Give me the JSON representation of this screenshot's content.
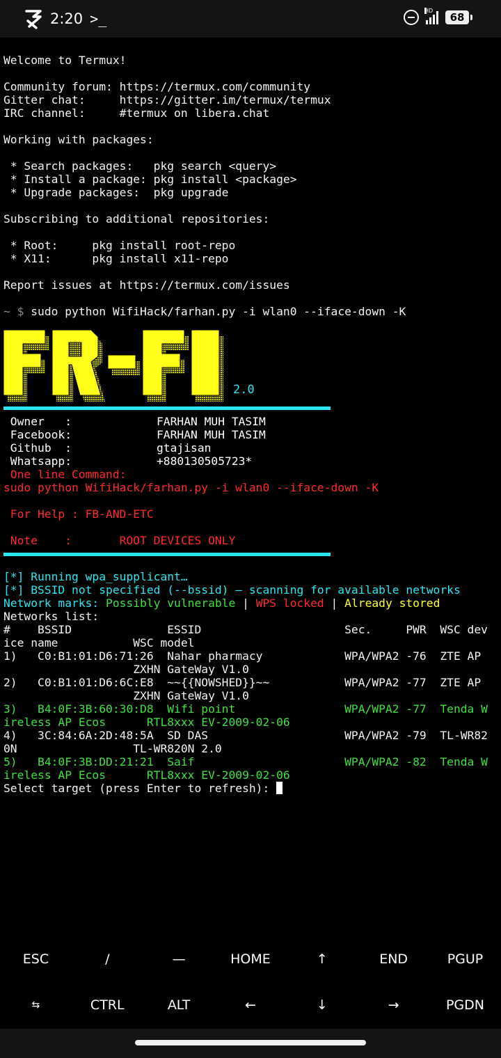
{
  "status_bar": {
    "time": "2:20",
    "app_icon": "termux-logo-icon",
    "prompt_icon": ">_",
    "network_label": "HD",
    "battery": "68"
  },
  "terminal": {
    "welcome": "Welcome to Termux!",
    "community_line": "Community forum: https://termux.com/community",
    "gitter_line": "Gitter chat:     https://gitter.im/termux/termux",
    "irc_line": "IRC channel:     #termux on libera.chat",
    "packages_header": "Working with packages:",
    "pkg_search": " * Search packages:   pkg search <query>",
    "pkg_install": " * Install a package: pkg install <package>",
    "pkg_upgrade": " * Upgrade packages:  pkg upgrade",
    "repos_header": "Subscribing to additional repositories:",
    "repo_root": " * Root:     pkg install root-repo",
    "repo_x11": " * X11:      pkg install x11-repo",
    "report_line": "Report issues at https://termux.com/issues",
    "prompt_symbol": "~ $",
    "command": " sudo python WifiHack/farhan.py -i wlan0 --iface-down -K"
  },
  "banner": {
    "logo_text": "FR-FI",
    "version": "2.0"
  },
  "info": {
    "owner_label": " Owner   :",
    "owner_value": "FARHAN MUH TASIM",
    "facebook_label": " Facebook:",
    "facebook_value": "FARHAN MUH TASIM",
    "github_label": " Github  :",
    "github_value": "gtajisan",
    "whatsapp_label": " Whatsapp:",
    "whatsapp_value": "+880130505723*",
    "oneline_label": " One line Command:",
    "oneline_cmd": "sudo python WifiHack/farhan.py -i wlan0 --iface-down -K",
    "help_line": " For Help : FB-AND-ETC",
    "note_line": " Note    :       ROOT DEVICES ONLY"
  },
  "scan": {
    "running": "[*] Running wpa_supplicant…",
    "bssid_notice": "[*] BSSID not specified (--bssid) — scanning for available networks",
    "marks_label": "Network marks:",
    "mark_vulnerable": " Possibly vulnerable",
    "sep": " | ",
    "mark_locked": "WPS locked",
    "mark_stored": "Already stored",
    "list_header": "Networks list:",
    "col_line1": "#    BSSID              ESSID                     Sec.     PWR  WSC dev",
    "col_line2": "ice name           WSC model",
    "rows": [
      {
        "line1": "1)   C0:B1:01:D6:71:26  Nahar pharmacy            WPA/WPA2 -76  ZTE AP",
        "line2": "                   ZXHN GateWay V1.0",
        "color": "#f2f2f2"
      },
      {
        "line1": "2)   C0:B1:01:D6:6C:E8  ~~{{NOWSHED}}~~           WPA/WPA2 -77  ZTE AP",
        "line2": "                   ZXHN GateWay V1.0",
        "color": "#f2f2f2"
      },
      {
        "line1": "3)   B4:0F:3B:60:30:D8  Wifi point                WPA/WPA2 -77  Tenda W",
        "line2": "ireless AP Ecos      RTL8xxx EV-2009-02-06",
        "color": "#3fe03f"
      },
      {
        "line1": "4)   3C:84:6A:2D:48:5A  SD DAS                    WPA/WPA2 -79  TL-WR82",
        "line2": "0N                 TL-WR820N 2.0",
        "color": "#f2f2f2"
      },
      {
        "line1": "5)   B4:0F:3B:DD:21:21  Saif                      WPA/WPA2 -82  Tenda W",
        "line2": "ireless AP Ecos      RTL8xxx EV-2009-02-06",
        "color": "#3fe03f"
      }
    ],
    "select_prompt": "Select target (press Enter to refresh): "
  },
  "extra_keys": {
    "row1": [
      "ESC",
      "/",
      "—",
      "HOME",
      "↑",
      "END",
      "PGUP"
    ],
    "row2": [
      "⇆",
      "CTRL",
      "ALT",
      "←",
      "↓",
      "→",
      "PGDN"
    ]
  },
  "colors": {
    "cyan": "#2ae6f0",
    "green": "#3fe03f",
    "red": "#ff2a2a",
    "yellow": "#ffff2e",
    "background": "#000000"
  }
}
